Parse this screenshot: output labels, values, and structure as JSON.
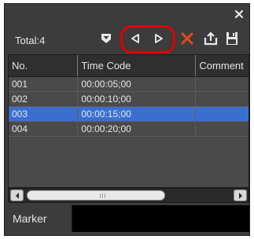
{
  "toolbar": {
    "total_label": "Total:4",
    "icons": [
      "bookmark-down-icon",
      "previous-marker-icon",
      "next-marker-icon",
      "delete-x-icon",
      "export-icon",
      "save-icon"
    ],
    "accent_red": "#e00000"
  },
  "table": {
    "headers": [
      "No.",
      "Time Code",
      "Comment"
    ],
    "rows": [
      {
        "no": "001",
        "time_code": "00:00:05;00",
        "comment": ""
      },
      {
        "no": "002",
        "time_code": "00:00:10;00",
        "comment": ""
      },
      {
        "no": "003",
        "time_code": "00:00:15;00",
        "comment": ""
      },
      {
        "no": "004",
        "time_code": "00:00:20;00",
        "comment": ""
      }
    ],
    "selected_row": "003",
    "selection_color": "#3a6fd0"
  },
  "tabs": [
    "Marker"
  ]
}
